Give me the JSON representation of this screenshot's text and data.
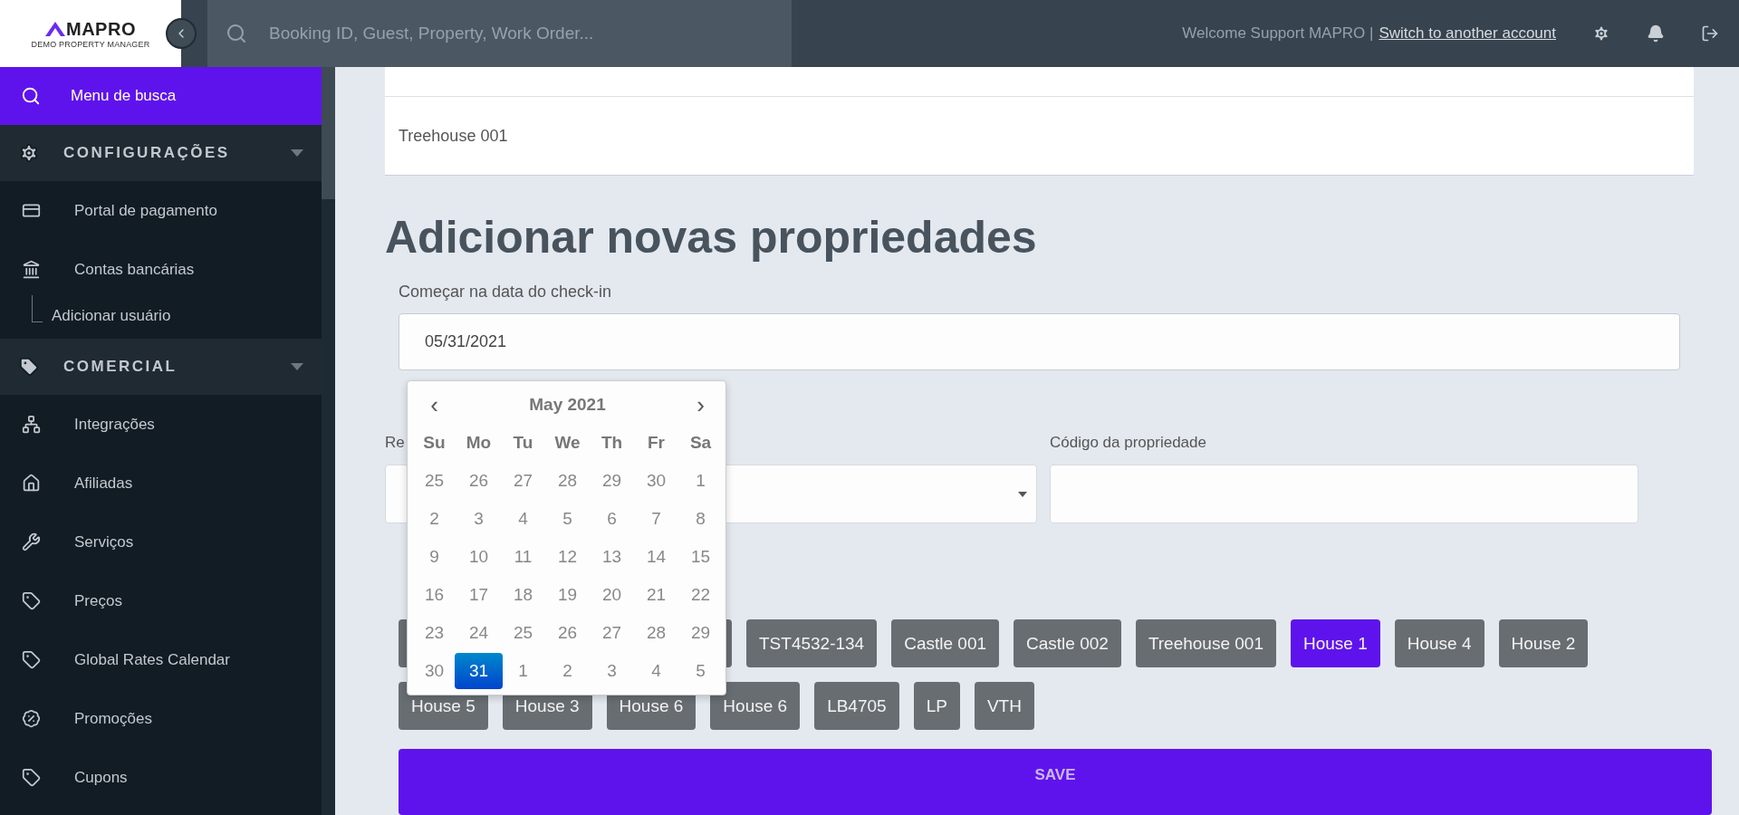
{
  "topbar": {
    "logo": {
      "name": "MAPRO",
      "tagline": "DEMO PROPERTY MANAGER"
    },
    "search": {
      "placeholder": "Booking ID, Guest, Property, Work Order..."
    },
    "welcome": "Welcome Support MAPRO |",
    "switch_link": "Switch to another account"
  },
  "sidebar": {
    "items": [
      {
        "kind": "search",
        "label": "Menu de busca",
        "selected": true
      },
      {
        "kind": "section",
        "label": "CONFIGURAÇÕES",
        "expanded": true,
        "children": [
          {
            "label": "Portal de pagamento",
            "selected": false
          },
          {
            "label": "Contas bancárias",
            "selected": false,
            "children": [
              {
                "label": "Adicionar usuário",
                "selected": false
              }
            ]
          }
        ]
      },
      {
        "kind": "section",
        "label": "COMERCIAL",
        "expanded": true,
        "children": [
          {
            "label": "Integrações",
            "selected": false
          },
          {
            "label": "Afiliadas",
            "selected": false
          },
          {
            "label": "Serviços",
            "selected": false
          },
          {
            "label": "Preços",
            "selected": false
          },
          {
            "label": "Global Rates Calendar",
            "selected": false
          },
          {
            "label": "Promoções",
            "selected": false
          },
          {
            "label": "Cupons",
            "selected": false
          }
        ]
      }
    ]
  },
  "card": {
    "rows": [
      "Treehouse 001"
    ]
  },
  "heading": "Adicionar novas propriedades",
  "form": {
    "date_label": "Começar na data do check-in",
    "date_value": "05/31/2021",
    "fields": [
      {
        "kind": "select",
        "label": "Re"
      },
      {
        "kind": "text",
        "label": "Código da propriedade"
      }
    ]
  },
  "calendar": {
    "month": "May 2021",
    "prev": "‹",
    "next": "›",
    "weekdays": [
      "Su",
      "Mo",
      "Tu",
      "We",
      "Th",
      "Fr",
      "Sa"
    ],
    "weeks": [
      [
        {
          "label": "25",
          "selected": false
        },
        {
          "label": "26",
          "selected": false
        },
        {
          "label": "27",
          "selected": false
        },
        {
          "label": "28",
          "selected": false
        },
        {
          "label": "29",
          "selected": false
        },
        {
          "label": "30",
          "selected": false
        },
        {
          "label": "1",
          "selected": false
        }
      ],
      [
        {
          "label": "2",
          "selected": false
        },
        {
          "label": "3",
          "selected": false
        },
        {
          "label": "4",
          "selected": false
        },
        {
          "label": "5",
          "selected": false
        },
        {
          "label": "6",
          "selected": false
        },
        {
          "label": "7",
          "selected": false
        },
        {
          "label": "8",
          "selected": false
        }
      ],
      [
        {
          "label": "9",
          "selected": false
        },
        {
          "label": "10",
          "selected": false
        },
        {
          "label": "11",
          "selected": false
        },
        {
          "label": "12",
          "selected": false
        },
        {
          "label": "13",
          "selected": false
        },
        {
          "label": "14",
          "selected": false
        },
        {
          "label": "15",
          "selected": false
        }
      ],
      [
        {
          "label": "16",
          "selected": false
        },
        {
          "label": "17",
          "selected": false
        },
        {
          "label": "18",
          "selected": false
        },
        {
          "label": "19",
          "selected": false
        },
        {
          "label": "20",
          "selected": false
        },
        {
          "label": "21",
          "selected": false
        },
        {
          "label": "22",
          "selected": false
        }
      ],
      [
        {
          "label": "23",
          "selected": false
        },
        {
          "label": "24",
          "selected": false
        },
        {
          "label": "25",
          "selected": false
        },
        {
          "label": "26",
          "selected": false
        },
        {
          "label": "27",
          "selected": false
        },
        {
          "label": "28",
          "selected": false
        },
        {
          "label": "29",
          "selected": false
        }
      ],
      [
        {
          "label": "30",
          "selected": false
        },
        {
          "label": "31",
          "selected": true
        },
        {
          "label": "1",
          "selected": false
        },
        {
          "label": "2",
          "selected": false
        },
        {
          "label": "3",
          "selected": false
        },
        {
          "label": "4",
          "selected": false
        },
        {
          "label": "5",
          "selected": false
        }
      ]
    ]
  },
  "properties": [
    {
      "kind": "covered",
      "selected": false
    },
    {
      "kind": "covered",
      "selected": false
    },
    {
      "kind": "chip",
      "label": "TST4532-134",
      "selected": false
    },
    {
      "kind": "chip",
      "label": "Castle 001",
      "selected": false
    },
    {
      "kind": "chip",
      "label": "Castle 002",
      "selected": false
    },
    {
      "kind": "chip",
      "label": "Treehouse 001",
      "selected": false
    },
    {
      "kind": "chip",
      "label": "House 1",
      "selected": true
    },
    {
      "kind": "chip",
      "label": "House 4",
      "selected": false
    },
    {
      "kind": "chip",
      "label": "House 2",
      "selected": false
    },
    {
      "kind": "chip",
      "label": "House 5",
      "selected": false
    },
    {
      "kind": "chip",
      "label": "House 3",
      "selected": false
    },
    {
      "kind": "chip",
      "label": "House 6",
      "selected": false
    },
    {
      "kind": "chip",
      "label": "House 6",
      "selected": false
    },
    {
      "kind": "chip",
      "label": "LB4705",
      "selected": false
    },
    {
      "kind": "chip",
      "label": "LP",
      "selected": false
    },
    {
      "kind": "chip",
      "label": "VTH",
      "selected": false
    }
  ],
  "save": "SAVE"
}
